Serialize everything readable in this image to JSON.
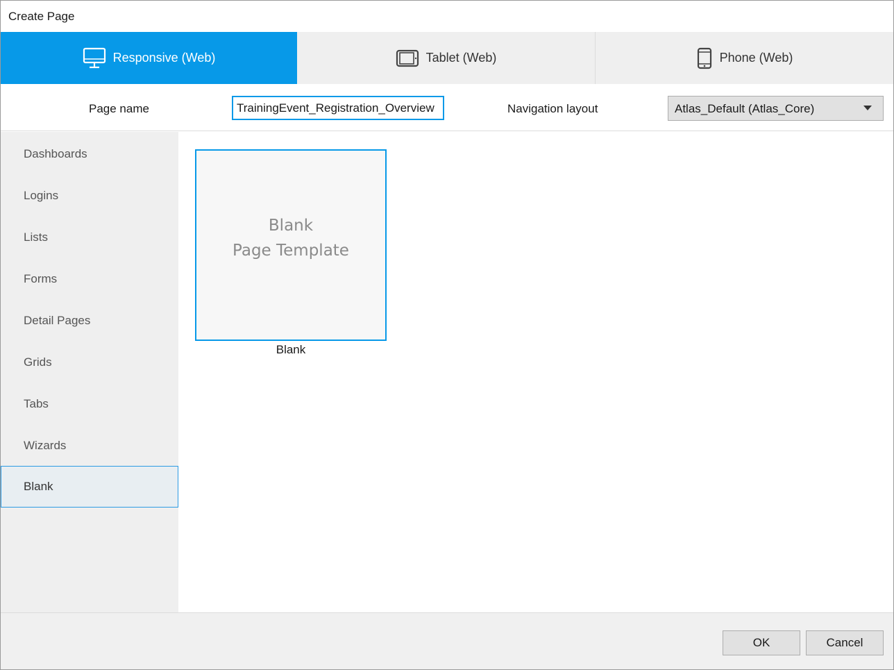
{
  "window": {
    "title": "Create Page"
  },
  "tabs": [
    {
      "label": "Responsive (Web)",
      "icon": "monitor-icon",
      "active": true
    },
    {
      "label": "Tablet (Web)",
      "icon": "tablet-icon",
      "active": false
    },
    {
      "label": "Phone (Web)",
      "icon": "phone-icon",
      "active": false
    }
  ],
  "form": {
    "page_name_label": "Page name",
    "page_name_value": "TrainingEvent_Registration_Overview",
    "navigation_layout_label": "Navigation layout",
    "navigation_layout_value": "Atlas_Default (Atlas_Core)"
  },
  "sidebar": {
    "items": [
      {
        "label": "Dashboards"
      },
      {
        "label": "Logins"
      },
      {
        "label": "Lists"
      },
      {
        "label": "Forms"
      },
      {
        "label": "Detail Pages"
      },
      {
        "label": "Grids"
      },
      {
        "label": "Tabs"
      },
      {
        "label": "Wizards"
      },
      {
        "label": "Blank",
        "selected": true
      }
    ]
  },
  "templates": [
    {
      "preview_line1": "Blank",
      "preview_line2": "Page Template",
      "caption": "Blank"
    }
  ],
  "footer": {
    "ok_label": "OK",
    "cancel_label": "Cancel"
  },
  "colors": {
    "accent": "#0799e8",
    "sidebar_bg": "#efefef",
    "tab_inactive_bg": "#efefef"
  }
}
